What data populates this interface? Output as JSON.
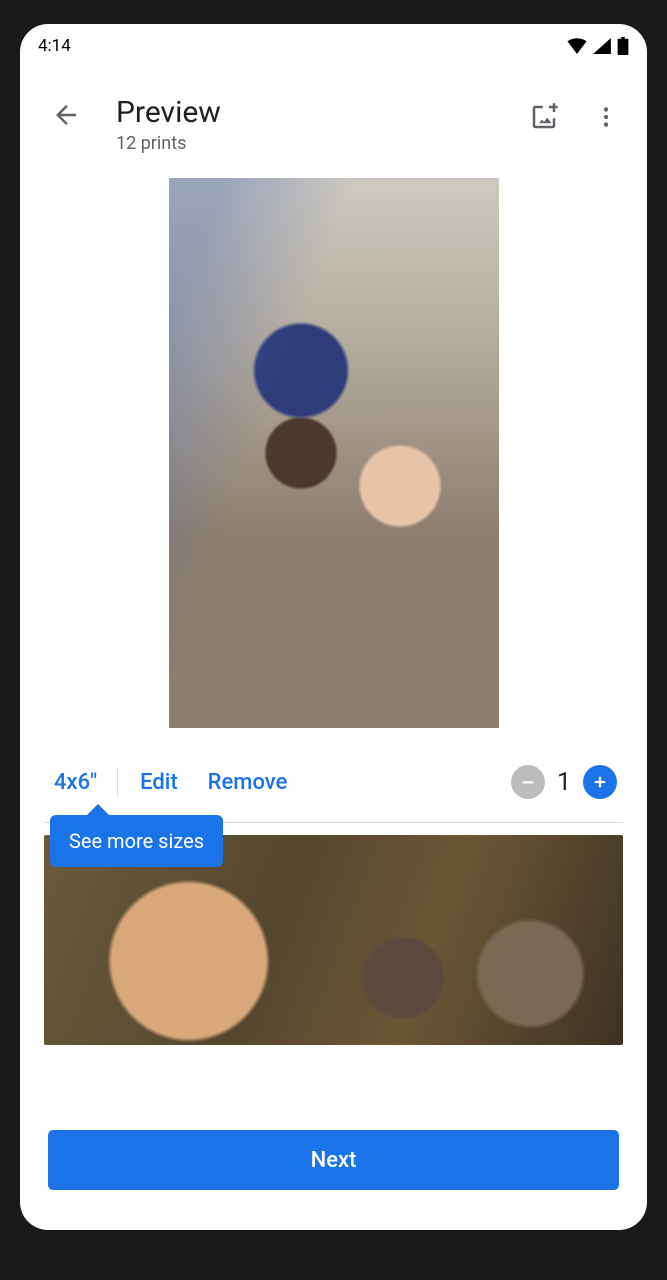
{
  "statusBar": {
    "time": "4:14"
  },
  "header": {
    "title": "Preview",
    "subtitle": "12 prints"
  },
  "controls": {
    "size": "4x6\"",
    "edit": "Edit",
    "remove": "Remove",
    "quantity": "1"
  },
  "tooltip": {
    "text": "See more sizes"
  },
  "footer": {
    "next": "Next"
  },
  "colors": {
    "accent": "#1a73e8",
    "muted": "#b5b5b5"
  }
}
